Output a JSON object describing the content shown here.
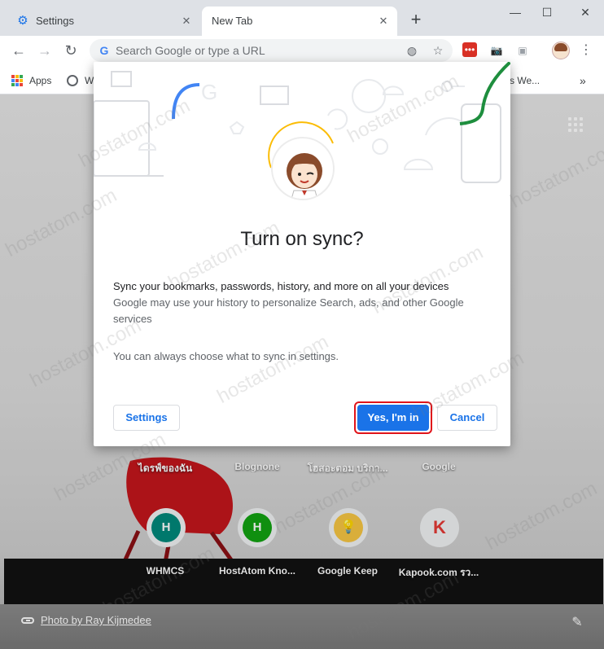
{
  "tabs": [
    {
      "title": "Settings",
      "active": false
    },
    {
      "title": "New Tab",
      "active": true
    }
  ],
  "omnibox": {
    "placeholder": "Search Google or type a URL"
  },
  "bookmarks": {
    "apps_label": "Apps",
    "item2_label": "W",
    "right_item_label": "s We...",
    "overflow": "»"
  },
  "dialog": {
    "title": "Turn on sync?",
    "body_line1": "Sync your bookmarks, passwords, history, and more on all your devices",
    "body_line2": "Google may use your history to personalize Search, ads, and other Google services",
    "note": "You can always choose what to sync in settings.",
    "settings_button": "Settings",
    "confirm_button": "Yes, I'm in",
    "cancel_button": "Cancel"
  },
  "shortcuts_top": [
    {
      "title": "ไดรฟ์ของฉัน"
    },
    {
      "title": "Blognone"
    },
    {
      "title": "โฮสอะตอม บริกา..."
    },
    {
      "title": "Google"
    }
  ],
  "shortcuts_bottom": [
    {
      "title": "WHMCS",
      "letter": "H",
      "color": "#00897b"
    },
    {
      "title": "HostAtom Kno...",
      "letter": "H",
      "color": "#12a312"
    },
    {
      "title": "Google Keep",
      "letter": "💡",
      "color": "#f7c744"
    },
    {
      "title": "Kapook.com รว...",
      "letter": "K",
      "color": "#f1f3f4"
    }
  ],
  "photo_credit": "Photo by Ray Kijmedee",
  "watermark": "hostatom.com",
  "colors": {
    "accent": "#1a73e8",
    "focus_ring": "#e0141a",
    "sync_green": "#1e8e3e"
  }
}
